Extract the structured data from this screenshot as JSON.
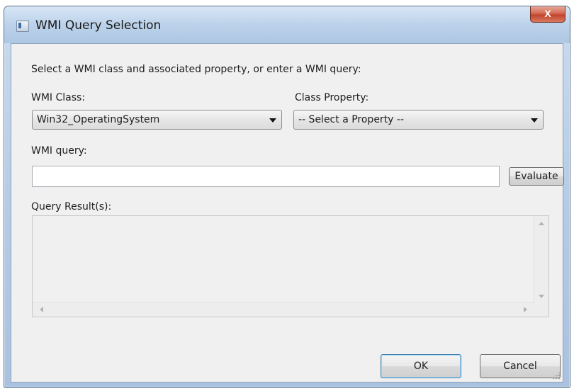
{
  "window": {
    "title": "WMI Query Selection",
    "close_glyph": "X"
  },
  "form": {
    "instruction": "Select a WMI class and associated property, or enter a WMI query:",
    "class_label": "WMI Class:",
    "class_value": "Win32_OperatingSystem",
    "property_label": "Class Property:",
    "property_value": "-- Select a Property --",
    "query_label": "WMI query:",
    "query_value": "",
    "evaluate_label": "Evaluate",
    "results_label": "Query Result(s):"
  },
  "buttons": {
    "ok_label": "OK",
    "cancel_label": "Cancel"
  },
  "icons": {
    "app": "window-icon",
    "close": "close-icon",
    "dropdown": "chevron-down-icon",
    "scroll_up": "scroll-up-icon",
    "scroll_down": "scroll-down-icon",
    "scroll_left": "scroll-left-icon",
    "scroll_right": "scroll-right-icon",
    "grip": "resize-grip-icon"
  },
  "colors": {
    "title_bar": "#bcd2ea",
    "close_button": "#c2452d",
    "client_background": "#f0f0f0",
    "default_button_border": "#3c7fb1"
  }
}
